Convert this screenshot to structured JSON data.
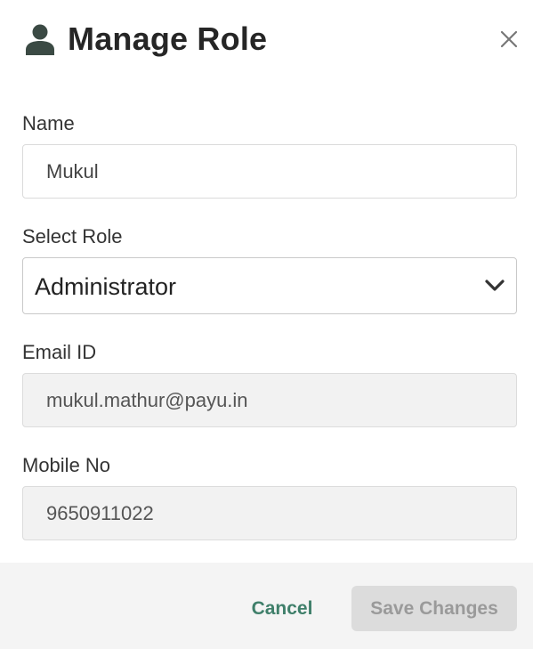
{
  "header": {
    "title": "Manage Role",
    "icon": "user-icon",
    "close_icon": "close-icon"
  },
  "form": {
    "name": {
      "label": "Name",
      "value": "Mukul"
    },
    "role": {
      "label": "Select Role",
      "selected": "Administrator"
    },
    "email": {
      "label": "Email ID",
      "value": "mukul.mathur@payu.in"
    },
    "mobile": {
      "label": "Mobile No",
      "value": "9650911022"
    }
  },
  "footer": {
    "cancel_label": "Cancel",
    "save_label": "Save Changes"
  },
  "colors": {
    "accent": "#3f7f6a",
    "disabled_button_bg": "#dcdcdc",
    "readonly_field_bg": "#f2f2f2"
  }
}
